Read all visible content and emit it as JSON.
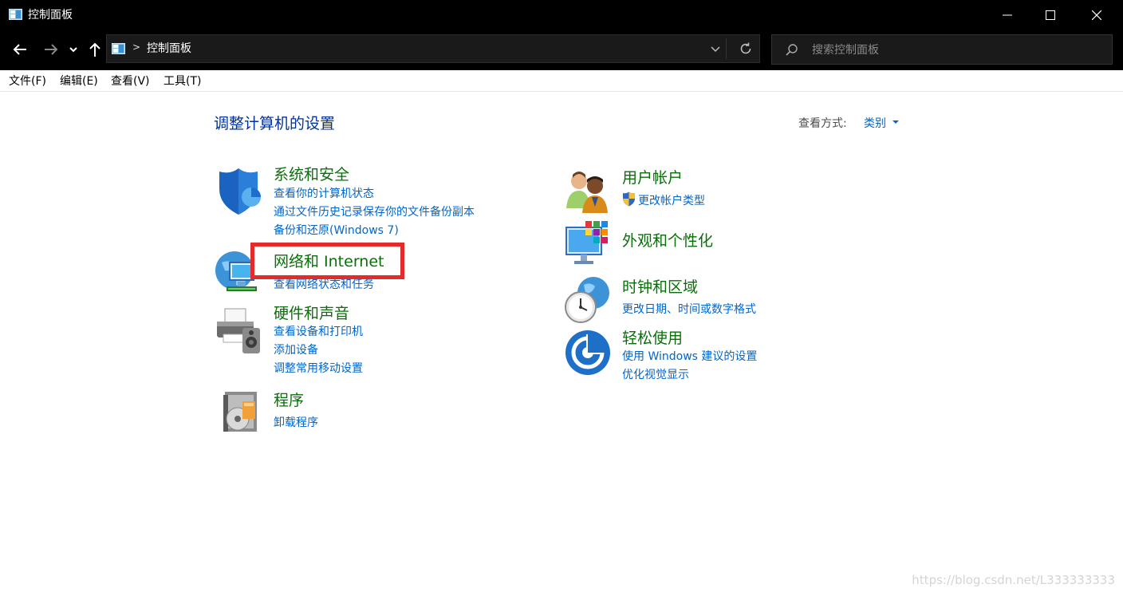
{
  "window": {
    "title": "控制面板",
    "controls": {
      "minimize": "minimize",
      "maximize": "maximize",
      "close": "close"
    }
  },
  "addressbar": {
    "separator": ">",
    "path": "控制面板"
  },
  "search": {
    "placeholder": "搜索控制面板"
  },
  "menu": {
    "items": [
      "文件(F)",
      "编辑(E)",
      "查看(V)",
      "工具(T)"
    ]
  },
  "main": {
    "heading": "调整计算机的设置",
    "view_by_label": "查看方式:",
    "view_by_value": "类别"
  },
  "categories": {
    "left": [
      {
        "title": "系统和安全",
        "icon": "shield-icon",
        "links": [
          "查看你的计算机状态",
          "通过文件历史记录保存你的文件备份副本",
          "备份和还原(Windows 7)"
        ]
      },
      {
        "title": "网络和 Internet",
        "icon": "network-globe-icon",
        "links": [
          "查看网络状态和任务"
        ]
      },
      {
        "title": "硬件和声音",
        "icon": "printer-icon",
        "links": [
          "查看设备和打印机",
          "添加设备",
          "调整常用移动设置"
        ]
      },
      {
        "title": "程序",
        "icon": "programs-disc-icon",
        "links": [
          "卸载程序"
        ]
      }
    ],
    "right": [
      {
        "title": "用户帐户",
        "icon": "users-icon",
        "links": [
          "更改帐户类型"
        ]
      },
      {
        "title": "外观和个性化",
        "icon": "monitor-palette-icon",
        "links": []
      },
      {
        "title": "时钟和区域",
        "icon": "clock-globe-icon",
        "links": [
          "更改日期、时间或数字格式"
        ]
      },
      {
        "title": "轻松使用",
        "icon": "ease-of-access-icon",
        "links": [
          "使用 Windows 建议的设置",
          "优化视觉显示"
        ]
      }
    ]
  },
  "watermark": "https://blog.csdn.net/L333333333",
  "colors": {
    "titlebar": "#000000",
    "category_title": "#0a6f0a",
    "link": "#0066cc",
    "heading": "#003399",
    "highlight_box": "#e32b2b"
  }
}
